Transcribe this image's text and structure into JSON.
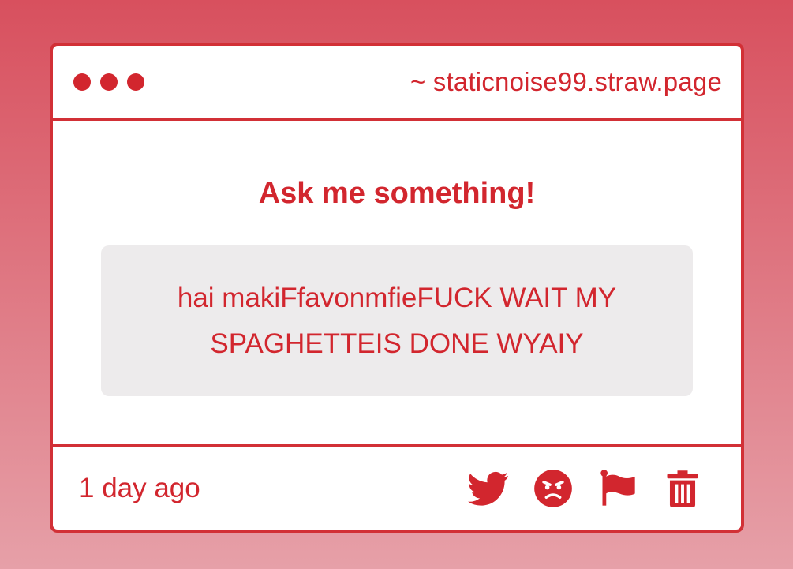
{
  "window": {
    "url": "~ staticnoise99.straw.page"
  },
  "content": {
    "heading": "Ask me something!",
    "question": "hai makiFfavonmfieFUCK WAIT MY SPAGHETTEIS DONE WYAIY"
  },
  "footer": {
    "timestamp": "1 day ago",
    "actions": [
      {
        "icon": "twitter-icon"
      },
      {
        "icon": "angry-face-icon"
      },
      {
        "icon": "flag-icon"
      },
      {
        "icon": "trash-icon"
      }
    ]
  },
  "colors": {
    "accent": "#d2262e",
    "background_top": "#d8505e",
    "background_bottom": "#e6a0a8",
    "question_box": "#edebec"
  }
}
